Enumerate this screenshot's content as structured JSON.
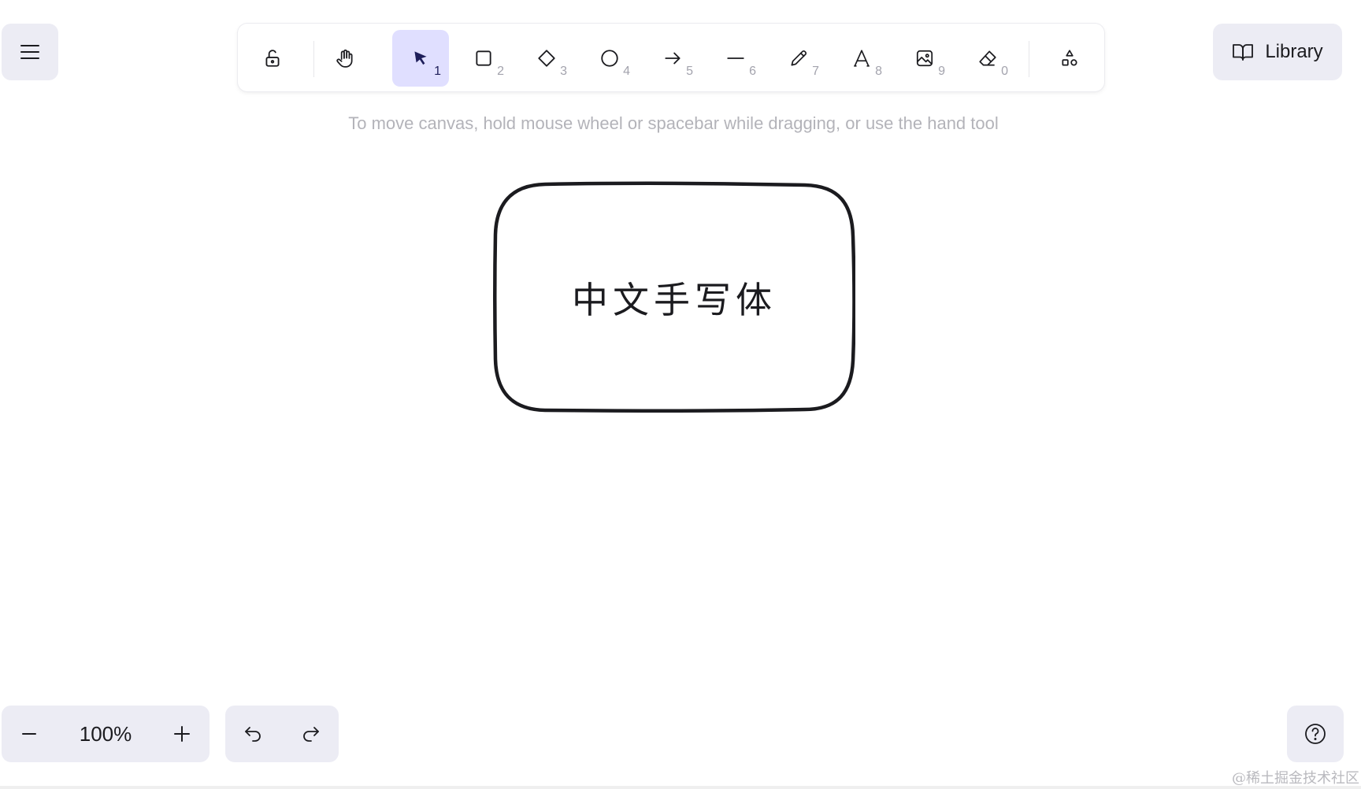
{
  "menu": {
    "icon": "hamburger-icon"
  },
  "toolbar": {
    "tools": [
      {
        "name": "lock",
        "icon": "unlock-icon",
        "key": ""
      },
      {
        "name": "hand",
        "icon": "hand-icon",
        "key": ""
      },
      {
        "name": "selection",
        "icon": "pointer-icon",
        "key": "1",
        "active": true
      },
      {
        "name": "rectangle",
        "icon": "square-icon",
        "key": "2"
      },
      {
        "name": "diamond",
        "icon": "diamond-icon",
        "key": "3"
      },
      {
        "name": "ellipse",
        "icon": "circle-icon",
        "key": "4"
      },
      {
        "name": "arrow",
        "icon": "arrow-right-icon",
        "key": "5"
      },
      {
        "name": "line",
        "icon": "line-icon",
        "key": "6"
      },
      {
        "name": "draw",
        "icon": "pencil-icon",
        "key": "7"
      },
      {
        "name": "text",
        "icon": "text-icon",
        "key": "8"
      },
      {
        "name": "image",
        "icon": "image-icon",
        "key": "9"
      },
      {
        "name": "eraser",
        "icon": "eraser-icon",
        "key": "0"
      },
      {
        "name": "more-shapes",
        "icon": "shapes-icon",
        "key": ""
      }
    ],
    "active_color": "#e0dfff"
  },
  "library": {
    "label": "Library",
    "icon": "book-icon"
  },
  "hint": "To move canvas, hold mouse wheel or spacebar while dragging, or use the hand tool",
  "canvas": {
    "shape_text": "中文手写体"
  },
  "zoom": {
    "value": "100%",
    "decrease_icon": "minus-icon",
    "increase_icon": "plus-icon"
  },
  "history": {
    "undo_icon": "undo-icon",
    "redo_icon": "redo-icon"
  },
  "help": {
    "icon": "help-icon"
  },
  "watermark": "@稀土掘金技术社区",
  "colors": {
    "panel": "#ececf4",
    "ink": "#1b1b1f",
    "muted": "#b3b3b9"
  }
}
